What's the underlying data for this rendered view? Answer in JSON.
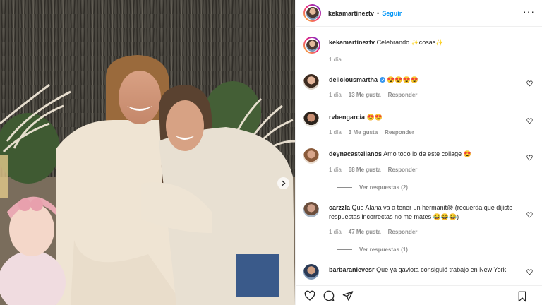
{
  "post": {
    "username": "kekamartineztv",
    "follow_label": "Seguir",
    "caption_user": "kekamartineztv",
    "caption_text": "Celebrando ✨cosas✨",
    "caption_time": "1 día"
  },
  "comments": [
    {
      "user": "deliciousmartha",
      "verified": true,
      "text": "😍😍😍😍",
      "time": "1 día",
      "likes": "13 Me gusta",
      "reply": "Responder"
    },
    {
      "user": "rvbengarcia",
      "verified": false,
      "text": "😍😍",
      "time": "1 día",
      "likes": "3 Me gusta",
      "reply": "Responder"
    },
    {
      "user": "deynacastellanos",
      "verified": false,
      "text": "Amo todo lo de este collage 😍",
      "time": "1 día",
      "likes": "68 Me gusta",
      "reply": "Responder",
      "view_replies": "Ver respuestas (2)"
    },
    {
      "user": "carzzla",
      "verified": false,
      "text": "Que Alana va a tener un hermanit@ (recuerda que dijiste respuestas incorrectas no me mates 😂😂😂)",
      "time": "1 día",
      "likes": "47 Me gusta",
      "reply": "Responder",
      "view_replies": "Ver respuestas (1)"
    },
    {
      "user": "barbaranievesr",
      "verified": false,
      "text": "Que ya gaviota consiguió trabajo en New York"
    }
  ],
  "colors": {
    "accent": "#0095f6",
    "muted": "#8e8e8e",
    "text": "#262626",
    "verified": "#3897f0"
  },
  "icons": [
    "heart-icon",
    "comment-icon",
    "share-icon",
    "bookmark-icon",
    "more-icon",
    "chevron-right-icon",
    "verified-badge-icon"
  ]
}
